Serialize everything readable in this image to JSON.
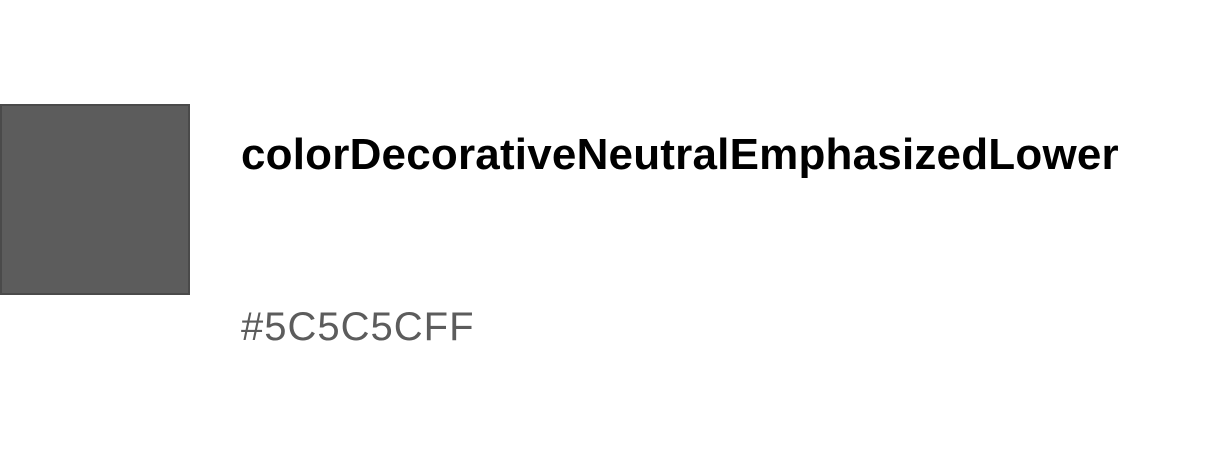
{
  "token": {
    "name": "colorDecorativeNeutralEmphasizedLower",
    "value": "#5C5C5CFF",
    "swatch_color": "#5C5C5C",
    "text_color": "#000000",
    "value_color": "#5C5C5C"
  }
}
